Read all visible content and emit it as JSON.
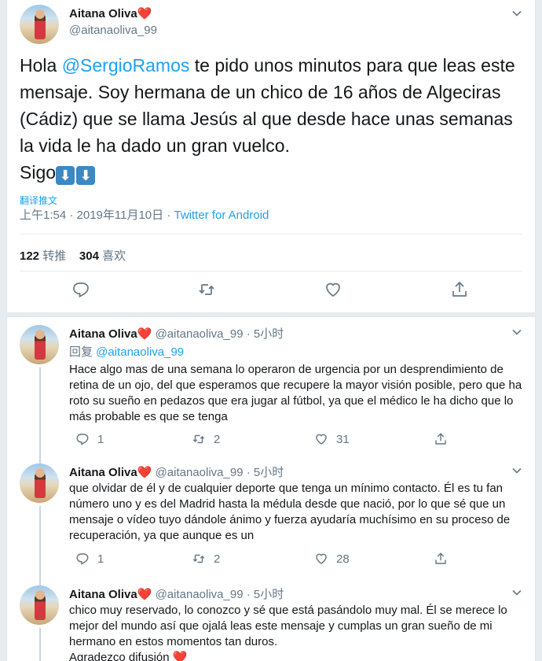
{
  "main_tweet": {
    "author_name": "Aitana Oliva",
    "heart": "❤️",
    "handle": "@aitanaoliva_99",
    "text_before": "Hola ",
    "mention": "@SergioRamos",
    "text_after": " te pido unos minutos para que leas este mensaje. Soy hermana de un chico de 16 años de Algeciras (Cádiz) que se llama Jesús al que desde hace unas semanas la vida le ha dado un gran vuelco.",
    "text_end": "Sigo",
    "arrows": [
      "⬇",
      "⬇"
    ],
    "translate_label": "翻译推文",
    "timestamp": "上午1:54 · 2019年11月10日 · ",
    "source": "Twitter for Android",
    "retweets_count": "122",
    "retweets_label": "转推",
    "likes_count": "304",
    "likes_label": "喜欢"
  },
  "replies": [
    {
      "author_name": "Aitana Oliva",
      "heart": "❤️",
      "handle": "@aitanaoliva_99",
      "time": "· 5小时",
      "reply_prefix": "回复 ",
      "reply_to": "@aitanaoliva_99",
      "text": "Hace algo mas de una semana lo operaron de urgencia por un desprendimiento de retina de un ojo, del que esperamos que recupere la mayor visión posible, pero que ha roto su sueño en pedazos que era jugar al fútbol, ya que el médico le ha dicho que lo más probable es que se tenga",
      "reply_count": "1",
      "retweet_count": "2",
      "like_count": "31"
    },
    {
      "author_name": "Aitana Oliva",
      "heart": "❤️",
      "handle": "@aitanaoliva_99",
      "time": "· 5小时",
      "text": "que olvidar de él y de cualquier deporte que tenga un mínimo contacto. Él es tu fan número uno y es del Madrid hasta la médula desde que nació, por lo que sé que un mensaje o vídeo tuyo dándole ánimo y fuerza ayudaría muchísimo en su proceso de recuperación, ya que aunque es un",
      "reply_count": "1",
      "retweet_count": "2",
      "like_count": "28"
    },
    {
      "author_name": "Aitana Oliva",
      "heart": "❤️",
      "handle": "@aitanaoliva_99",
      "time": "· 5小时",
      "text": "chico muy reservado, lo conozco y sé que está pasándolo muy mal. Él se merece lo mejor del mundo así que ojalá leas este mensaje y cumplas un gran sueño de mi hermano en estos momentos tan duros.",
      "text_line2": "Agradezco difusión ",
      "text_heart": "❤️"
    }
  ],
  "icons": {
    "chevron": "chevron-down-icon",
    "reply": "reply-icon",
    "retweet": "retweet-icon",
    "like": "heart-icon",
    "share": "share-icon"
  }
}
